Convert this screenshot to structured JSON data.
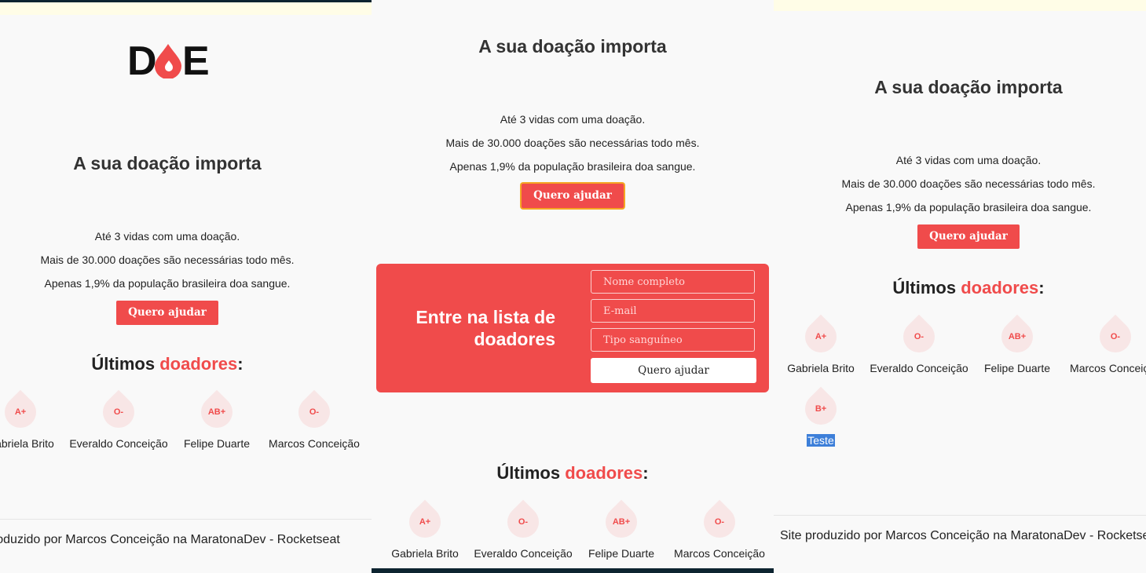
{
  "colors": {
    "accent": "#f04b4b",
    "background": "#f9f9f9",
    "drop": "#f8e6e6",
    "top_bar_dark": "#0d2430",
    "top_bar_light": "#fffde7"
  },
  "logo": {
    "text": "DOE",
    "icon": "blood-drop-icon"
  },
  "hero": {
    "title": "A sua doação importa",
    "lines": [
      "Até 3 vidas com uma doação.",
      "Mais de 30.000 doações são necessárias todo mês.",
      "Apenas 1,9% da população brasileira doa sangue."
    ],
    "cta_label": "Quero ajudar"
  },
  "form": {
    "title": "Entre na lista de doadores",
    "name_placeholder": "Nome completo",
    "email_placeholder": "E-mail",
    "blood_placeholder": "Tipo sanguíneo",
    "submit_label": "Quero ajudar"
  },
  "donors": {
    "heading_prefix": "Últimos",
    "heading_highlight": "doadores",
    "heading_suffix": ":",
    "items": [
      {
        "blood": "A+",
        "name": "Gabriela Brito"
      },
      {
        "blood": "O-",
        "name": "Everaldo Conceição"
      },
      {
        "blood": "AB+",
        "name": "Felipe Duarte"
      },
      {
        "blood": "O-",
        "name": "Marcos Conceição"
      },
      {
        "blood": "B+",
        "name": "Teste"
      }
    ]
  },
  "footer": {
    "text": "Site produzido por Marcos Conceição na MaratonaDev - Rocketseat"
  }
}
